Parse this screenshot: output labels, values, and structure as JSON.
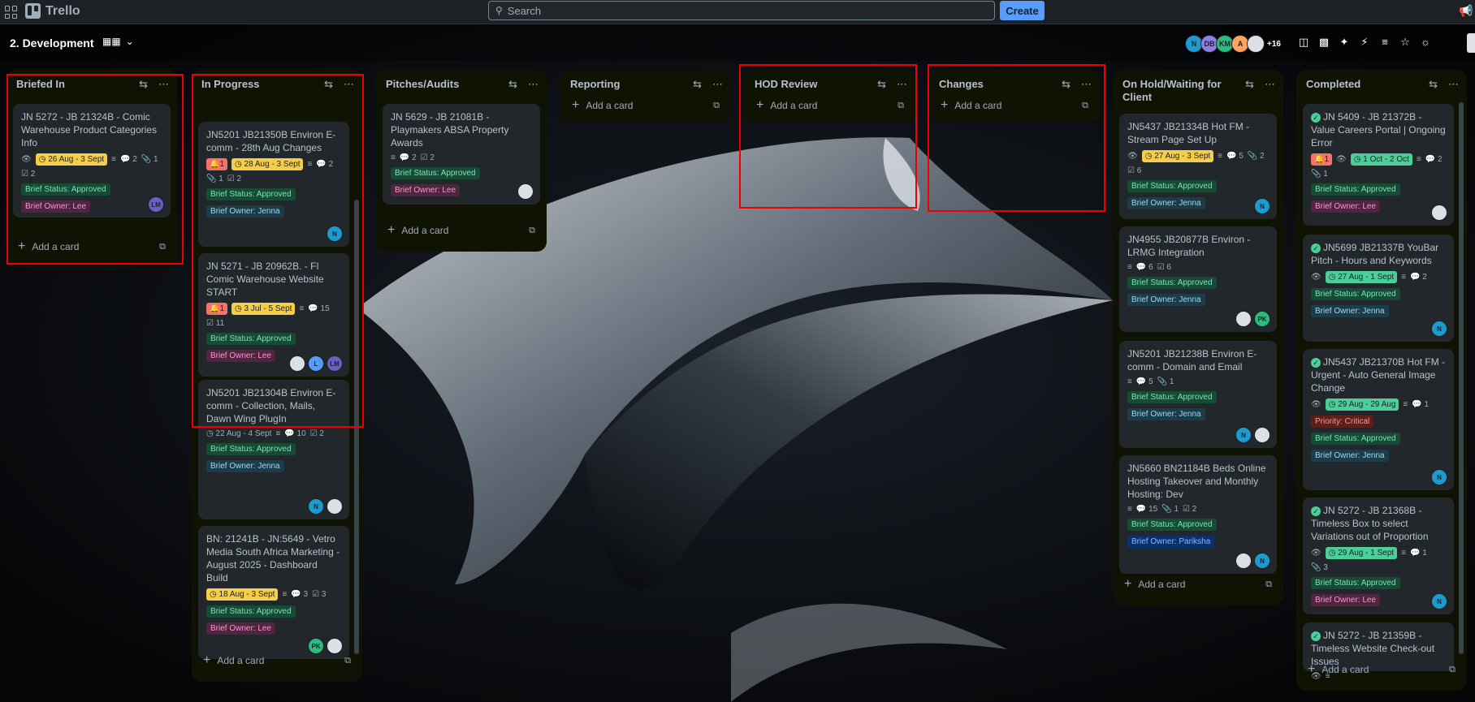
{
  "app": {
    "name": "Trello",
    "search_placeholder": "Search",
    "create_label": "Create"
  },
  "board": {
    "title": "2. Development",
    "member_overflow": "+16",
    "members": [
      {
        "initials": "N",
        "color": "#1d9bd1"
      },
      {
        "initials": "DB",
        "color": "#8f7ee7"
      },
      {
        "initials": "KM",
        "color": "#2abb7f"
      },
      {
        "initials": "A",
        "color": "#fea362"
      },
      {
        "initials": "",
        "color": "#dcdfe4"
      }
    ]
  },
  "lists": [
    {
      "title": "Briefed In",
      "add": "Add a card",
      "cards": [
        {
          "title": "JN 5272 - JB 21324B - Comic Warehouse Product Categories Info",
          "due": "26 Aug - 3 Sept",
          "comments": "2",
          "attachments": "1",
          "checklist": "2",
          "labels": [
            "Brief Status: Approved",
            "Brief Owner: Lee"
          ],
          "members": [
            "LM"
          ]
        }
      ]
    },
    {
      "title": "In Progress",
      "add": "Add a card",
      "cards": [
        {
          "title": "JN5201 JB21350B Environ E-comm - 28th Aug Changes",
          "notif": "1",
          "due": "28 Aug - 3 Sept",
          "comments": "2",
          "attachments": "1",
          "checklist": "2",
          "labels": [
            "Brief Status: Approved",
            "Brief Owner: Jenna"
          ],
          "members": [
            "N"
          ]
        },
        {
          "title": "JN 5271 - JB 20962B. - FI Comic Warehouse Website START",
          "notif": "1",
          "due": "3 Jul - 5 Sept",
          "comments": "15",
          "checklist": "11",
          "labels": [
            "Brief Status: Approved",
            "Brief Owner: Lee"
          ],
          "members": [
            "",
            "L",
            "LM"
          ]
        },
        {
          "title": "JN5201 JB21304B Environ E-comm - Collection, Mails, Dawn Wing PlugIn",
          "due": "22 Aug - 4 Sept",
          "comments": "10",
          "checklist": "2",
          "labels": [
            "Brief Status: Approved",
            "Brief Owner: Jenna"
          ],
          "members": [
            "N",
            ""
          ]
        },
        {
          "title": "BN: 21241B - JN:5649 - Vetro Media South Africa Marketing - August 2025 - Dashboard Build",
          "due": "18 Aug - 3 Sept",
          "comments": "3",
          "checklist": "3",
          "labels": [
            "Brief Status: Approved",
            "Brief Owner: Lee"
          ],
          "members": [
            "PK",
            ""
          ]
        }
      ]
    },
    {
      "title": "Pitches/Audits",
      "add": "Add a card",
      "cards": [
        {
          "title": "JN 5629 - JB 21081B - Playmakers ABSA Property Awards",
          "comments": "2",
          "checklist": "2",
          "labels": [
            "Brief Status: Approved",
            "Brief Owner: Lee"
          ],
          "members": [
            ""
          ]
        }
      ]
    },
    {
      "title": "Reporting",
      "add": "Add a card",
      "cards": []
    },
    {
      "title": "HOD Review",
      "add": "Add a card",
      "cards": []
    },
    {
      "title": "Changes",
      "add": "Add a card",
      "cards": []
    },
    {
      "title": "On Hold/Waiting for Client",
      "add": "Add a card",
      "cards": [
        {
          "title": "JN5437 JB21334B Hot FM - Stream Page Set Up",
          "due": "27 Aug - 3 Sept",
          "comments": "5",
          "attachments": "2",
          "checklist": "6",
          "labels": [
            "Brief Status: Approved",
            "Brief Owner: Jenna"
          ],
          "members": [
            "N"
          ]
        },
        {
          "title": "JN4955 JB20877B Environ - LRMG Integration",
          "comments": "6",
          "checklist": "6",
          "labels": [
            "Brief Status: Approved",
            "Brief Owner: Jenna"
          ],
          "members": [
            "",
            "PK"
          ]
        },
        {
          "title": "JN5201 JB21238B Environ E-comm - Domain and Email",
          "comments": "5",
          "attachments": "1",
          "labels": [
            "Brief Status: Approved",
            "Brief Owner: Jenna"
          ],
          "members": [
            "N",
            ""
          ]
        },
        {
          "title": "JN5660 BN21184B Beds Online Hosting Takeover and Monthly Hosting: Dev",
          "comments": "15",
          "attachments": "1",
          "checklist": "2",
          "labels": [
            "Brief Status: Approved",
            "Brief Owner: Pariksha"
          ],
          "members": [
            "",
            "N"
          ]
        }
      ]
    },
    {
      "title": "Completed",
      "add": "Add a card",
      "cards": [
        {
          "title": "JN 5409 - JB 21372B - Value Careers Portal | Ongoing Error",
          "notif": "1",
          "due": "1 Oct - 2 Oct",
          "comments": "2",
          "attachments": "1",
          "labels": [
            "Brief Status: Approved",
            "Brief Owner: Lee"
          ],
          "members": [
            ""
          ]
        },
        {
          "title": "JN5699 JB21337B YouBar Pitch - Hours and Keywords",
          "due": "27 Aug - 1 Sept",
          "comments": "2",
          "labels": [
            "Brief Status: Approved",
            "Brief Owner: Jenna"
          ],
          "members": [
            "N"
          ]
        },
        {
          "title": "JN5437 JB21370B Hot FM - Urgent - Auto General Image Change",
          "due": "29 Aug - 29 Aug",
          "comments": "1",
          "labels": [
            "Priority: Critical",
            "Brief Status: Approved",
            "Brief Owner: Jenna"
          ],
          "members": [
            "N"
          ]
        },
        {
          "title": "JN 5272 - JB 21368B - Timeless Box to select Variations out of Proportion",
          "due": "29 Aug - 1 Sept",
          "comments": "1",
          "attachments": "3",
          "labels": [
            "Brief Status: Approved",
            "Brief Owner: Lee"
          ],
          "members": [
            "N"
          ]
        },
        {
          "title": "JN 5272 - JB 21359B - Timeless Website Check-out Issues"
        }
      ]
    }
  ],
  "colors": {
    "accent": "#579dff",
    "highlight": "#ff0000"
  }
}
